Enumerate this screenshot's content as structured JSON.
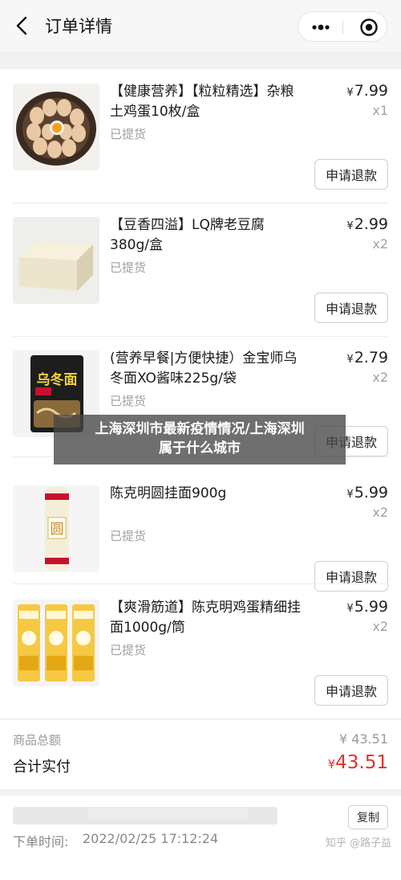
{
  "header": {
    "title": "订单详情",
    "back_icon": "chevron-left-icon",
    "more_icon": "more-dots-icon",
    "close_icon": "target-circle-icon"
  },
  "items": [
    {
      "name": "【健康营养】【粒粒精选】杂粮土鸡蛋10枚/盒",
      "status": "已提货",
      "currency": "¥",
      "price": "7.99",
      "qty": "x1",
      "refund_label": "申请退款",
      "thumb": "eggs-image"
    },
    {
      "name": "【豆香四溢】LQ牌老豆腐380g/盒",
      "status": "已提货",
      "currency": "¥",
      "price": "2.99",
      "qty": "x2",
      "refund_label": "申请退款",
      "thumb": "tofu-image"
    },
    {
      "name": "(营养早餐|方便快捷）金宝师乌冬面XO酱味225g/袋",
      "status": "已提货",
      "currency": "¥",
      "price": "2.79",
      "qty": "x2",
      "refund_label": "申请退款",
      "thumb": "udon-pack-image",
      "thumb_text": "乌冬面"
    },
    {
      "name": "陈克明圆挂面900g",
      "status": "已提货",
      "currency": "¥",
      "price": "5.99",
      "qty": "x2",
      "refund_label": "申请退款",
      "thumb": "noodle-roll-image",
      "thumb_text": "圆"
    },
    {
      "name": "【爽滑筋道】陈克明鸡蛋精细挂面1000g/筒",
      "status": "已提货",
      "currency": "¥",
      "price": "5.99",
      "qty": "x2",
      "refund_label": "申请退款",
      "thumb": "egg-noodle-packs-image"
    }
  ],
  "summary": {
    "goods_total_label": "商品总额",
    "goods_total_value": "¥ 43.51",
    "actual_label": "合计实付",
    "actual_currency": "¥",
    "actual_value": "43.51",
    "accent_color": "#e0322b"
  },
  "order_info": {
    "copy_label": "复制",
    "time_label": "下单时间:",
    "time_value": "2022/02/25 17:12:24",
    "watermark": "知乎 @路子益"
  },
  "overlay": {
    "line1": "上海深圳市最新疫情情况/上海深圳",
    "line2": "属于什么城市"
  }
}
